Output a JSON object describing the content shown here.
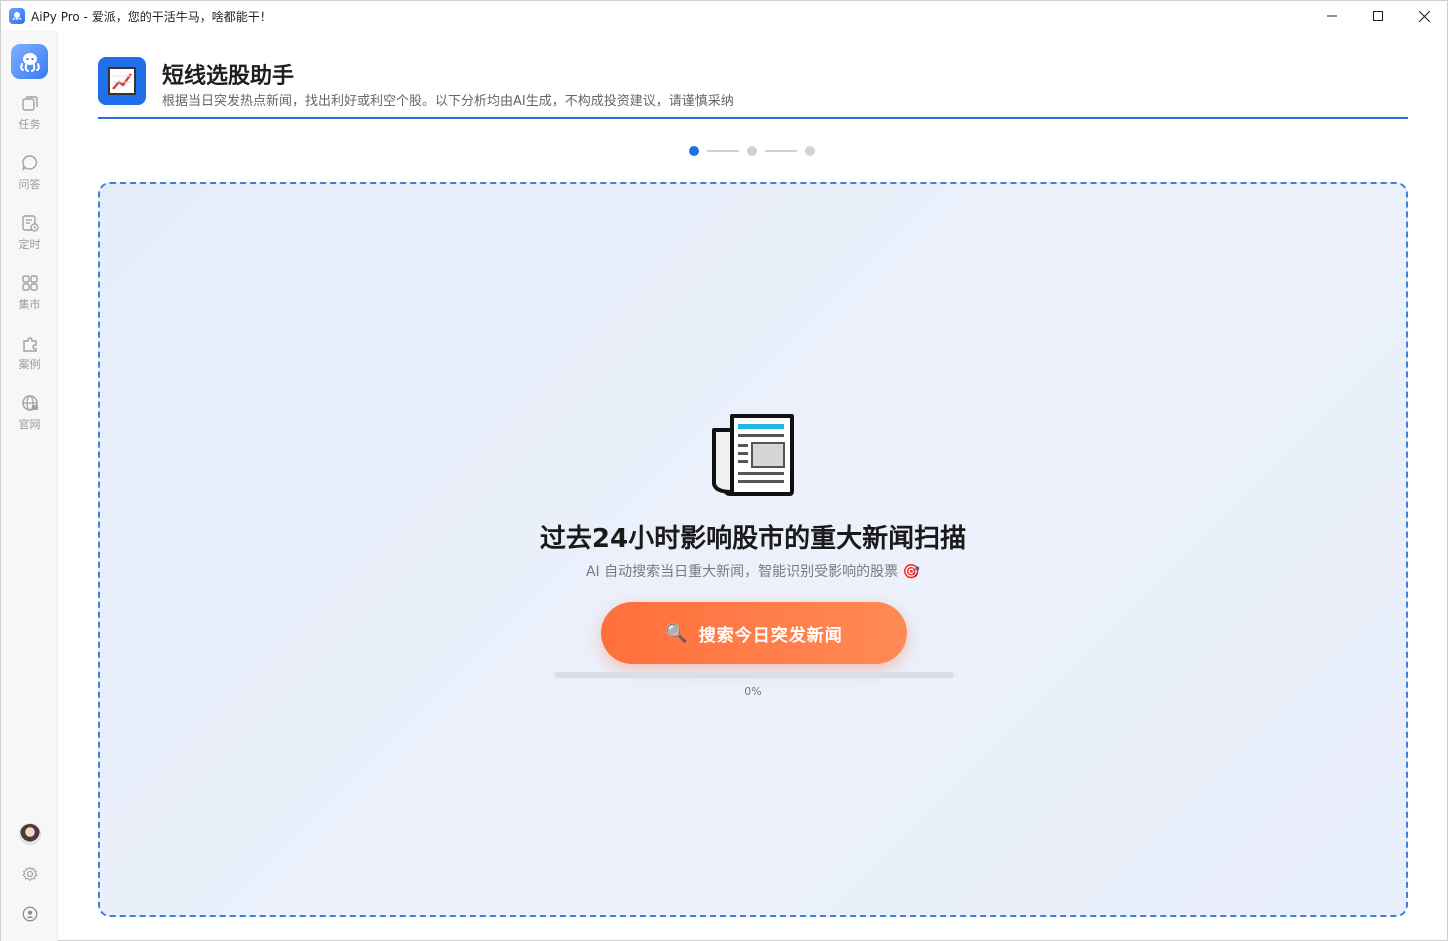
{
  "window": {
    "title": "AiPy Pro - 爱派，您的干活牛马，啥都能干！",
    "app_icon": "octopus-logo-icon",
    "controls": {
      "minimize": "—",
      "maximize": "☐",
      "close": "✕"
    }
  },
  "sidebar": {
    "logo_icon": "octopus-logo-icon",
    "items": [
      {
        "label": "任务",
        "icon": "layers-icon"
      },
      {
        "label": "问答",
        "icon": "chat-icon"
      },
      {
        "label": "定时",
        "icon": "schedule-icon"
      },
      {
        "label": "集市",
        "icon": "grid-icon"
      },
      {
        "label": "案例",
        "icon": "puzzle-icon"
      },
      {
        "label": "官网",
        "icon": "globe-icon"
      }
    ],
    "bottom": [
      {
        "icon": "avatar-icon"
      },
      {
        "icon": "gear-icon"
      },
      {
        "icon": "user-circle-icon"
      }
    ]
  },
  "header": {
    "icon": "chart-up-icon",
    "title": "短线选股助手",
    "subtitle": "根据当日突发热点新闻，找出利好或利空个股。以下分析均由AI生成，不构成投资建议，请谨慎采纳",
    "accent_color": "#1f6fe8"
  },
  "steps": {
    "current": 1,
    "total": 3
  },
  "scan": {
    "icon": "newspaper-icon",
    "title": "过去24小时影响股市的重大新闻扫描",
    "description": "AI 自动搜索当日重大新闻，智能识别受影响的股票 🎯",
    "button_label": "搜索今日突发新闻",
    "button_icon": "🔍",
    "button_color": "#ff7a45",
    "progress_percent": 0,
    "progress_text": "0%"
  }
}
